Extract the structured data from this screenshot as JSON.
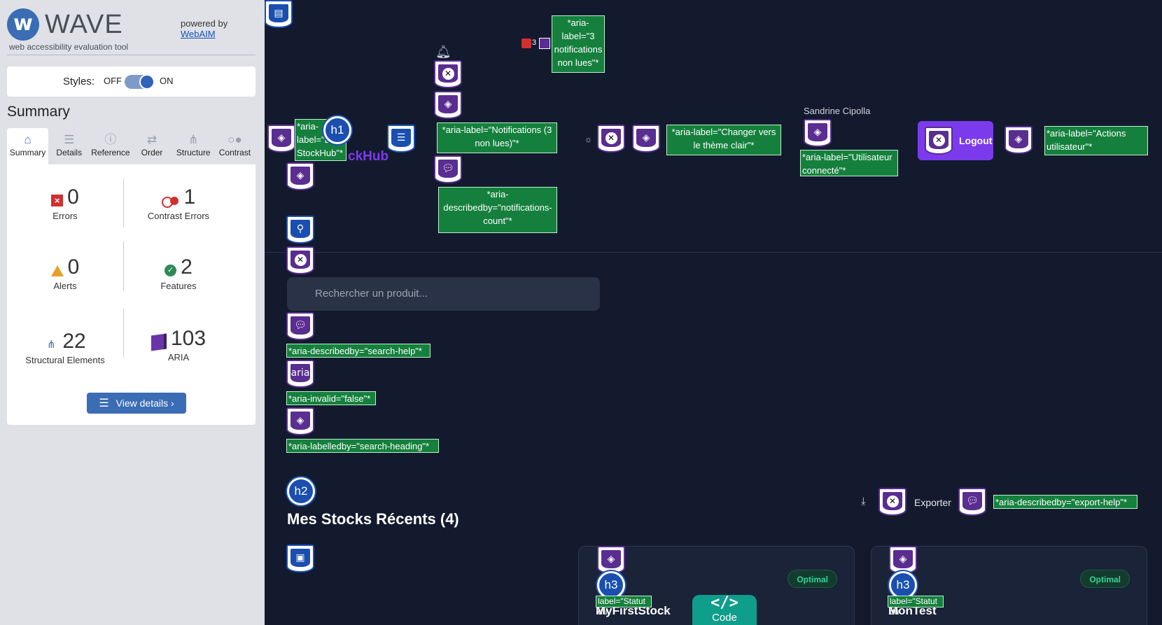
{
  "wave": {
    "logo_letter": "w",
    "name": "WAVE",
    "tagline": "web accessibility evaluation tool",
    "powered_by": "powered by",
    "webaim": "WebAIM",
    "styles_label": "Styles:",
    "styles_off": "OFF",
    "styles_on": "ON",
    "summary_heading": "Summary",
    "tabs": [
      {
        "label": "Summary",
        "icon": "home-icon"
      },
      {
        "label": "Details",
        "icon": "list-icon"
      },
      {
        "label": "Reference",
        "icon": "info-icon"
      },
      {
        "label": "Order",
        "icon": "order-icon"
      },
      {
        "label": "Structure",
        "icon": "structure-icon"
      },
      {
        "label": "Contrast",
        "icon": "contrast-icon"
      }
    ],
    "stats": {
      "errors": {
        "value": "0",
        "label": "Errors"
      },
      "contrast": {
        "value": "1",
        "label": "Contrast Errors"
      },
      "alerts": {
        "value": "0",
        "label": "Alerts"
      },
      "features": {
        "value": "2",
        "label": "Features"
      },
      "structural": {
        "value": "22",
        "label": "Structural Elements"
      },
      "aria": {
        "value": "103",
        "label": "ARIA"
      }
    },
    "view_details": "View details ›"
  },
  "app": {
    "brand_partial": "ckHub",
    "notif_count": "3",
    "user_name": "Sandrine Cipolla",
    "logout": "Logout",
    "search_placeholder": "Rechercher un produit...",
    "section_title": "Mes Stocks Récents (4)",
    "export": "Exporter",
    "code_label": "Code",
    "cards": [
      {
        "status": "Optimal",
        "name": "MyFirstStock"
      },
      {
        "status": "Optimal",
        "name": "MonTest"
      }
    ]
  },
  "annotations": {
    "h1": "h1",
    "h2": "h2",
    "h3": "h3",
    "aria_text": "aria",
    "logo_label": "*aria-label=\"Logo StockHub\"*",
    "notif_count_label": "*aria-label=\"3 notifications non lues\"*",
    "notif_label": "*aria-label=\"Notifications (3 non lues)\"*",
    "notif_describedby": "*aria-describedby=\"notifications-count\"*",
    "theme_label": "*aria-label=\"Changer vers le thème clair\"*",
    "user_label": "*aria-label=\"Utilisateur connecté\"*",
    "actions_label": "*aria-label=\"Actions utilisateur\"*",
    "search_describedby": "*aria-describedby=\"search-help\"*",
    "search_invalid": "*aria-invalid=\"false\"*",
    "search_labelledby": "*aria-labelledby=\"search-heading\"*",
    "export_describedby": "*aria-describedby=\"export-help\"*",
    "card_label_partial": "label=\"Statut du"
  },
  "colors": {
    "wave_blue": "#3b6db5",
    "app_bg": "#131a2e",
    "brand_purple": "#7c3aed",
    "annotation_green": "#15803d",
    "status_green": "#34d399"
  }
}
